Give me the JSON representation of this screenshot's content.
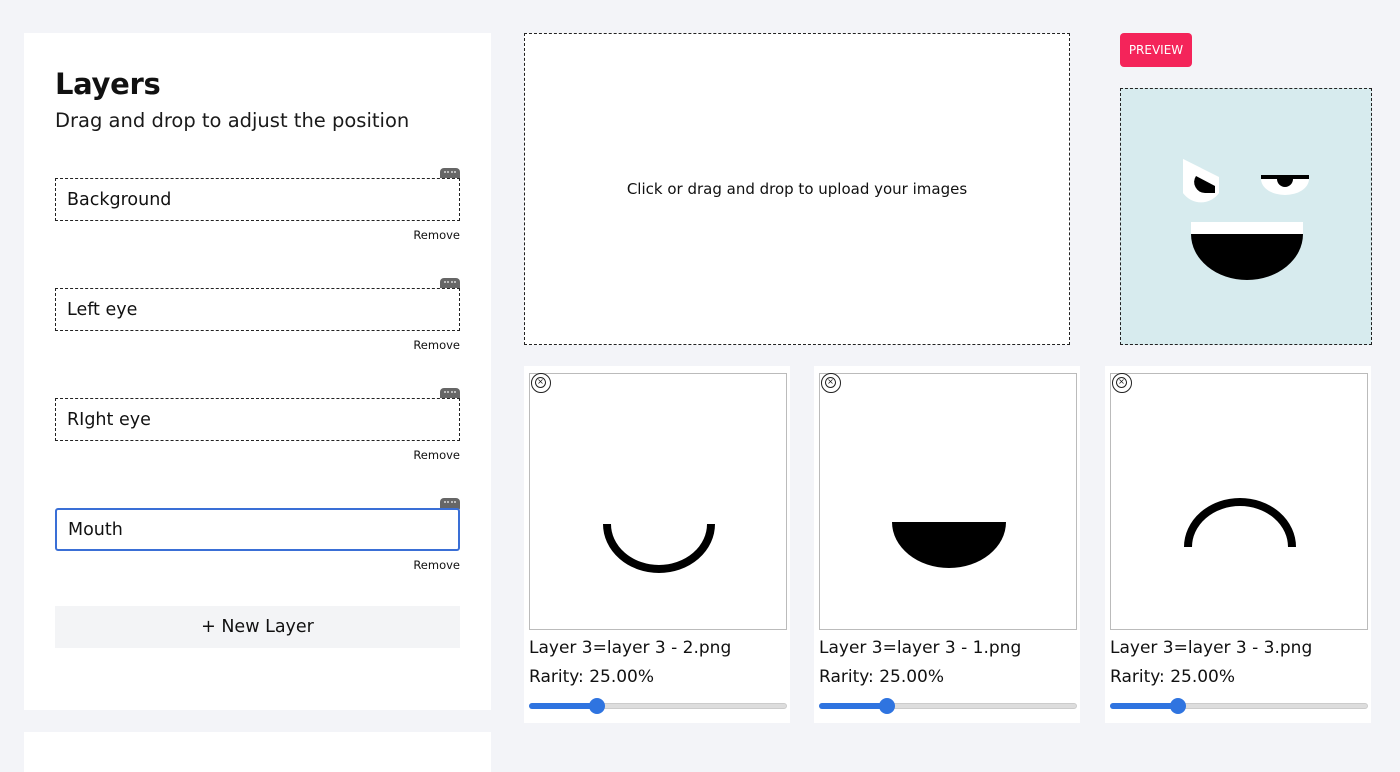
{
  "layers_panel": {
    "title": "Layers",
    "subtitle": "Drag and drop to adjust the position",
    "layers": [
      {
        "name": "Background",
        "remove_label": "Remove"
      },
      {
        "name": "Left eye",
        "remove_label": "Remove"
      },
      {
        "name": "RIght eye",
        "remove_label": "Remove"
      },
      {
        "name": "Mouth",
        "remove_label": "Remove"
      }
    ],
    "new_layer_label": "+ New Layer"
  },
  "upload": {
    "prompt": "Click or drag and drop to upload your images"
  },
  "preview": {
    "button_label": "PREVIEW",
    "background_color": "#d7ebee"
  },
  "images": [
    {
      "filename": "Layer 3=layer 3 - 2.png",
      "rarity_label": "Rarity: 25.00%",
      "rarity_value": 0.25,
      "shape": "smile-arc-icon"
    },
    {
      "filename": "Layer 3=layer 3 - 1.png",
      "rarity_label": "Rarity: 25.00%",
      "rarity_value": 0.25,
      "shape": "half-circle-mouth-icon"
    },
    {
      "filename": "Layer 3=layer 3 - 3.png",
      "rarity_label": "Rarity: 25.00%",
      "rarity_value": 0.25,
      "shape": "frown-arc-icon"
    }
  ],
  "colors": {
    "accent": "#2f74e0",
    "preview_button": "#f4245a",
    "active_border": "#3a6fd6"
  }
}
